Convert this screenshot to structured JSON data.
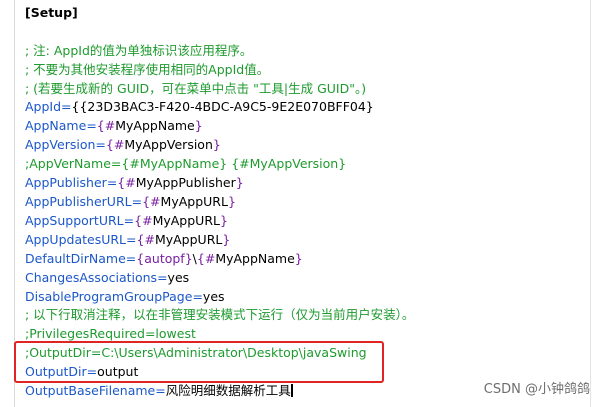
{
  "section": "[Setup]",
  "lines": {
    "c1": "; 注: AppId的值为单独标识该应用程序。",
    "c2": "; 不要为其他安装程序使用相同的AppId值。",
    "c3": "; (若要生成新的 GUID，可在菜单中点击 \"工具|生成 GUID\"。)",
    "appid_key": "AppId",
    "appid_val": "{{23D3BAC3-F420-4BDC-A9C5-9E2E070BFF04}",
    "appname_key": "AppName",
    "appname_const": "{#",
    "appname_val": "MyAppName",
    "appname_close": "}",
    "appversion_key": "AppVersion",
    "appversion_const": "{#",
    "appversion_val": "MyAppVersion",
    "appversion_close": "}",
    "appvername_comment": ";AppVerName={#MyAppName} {#MyAppVersion}",
    "publisher_key": "AppPublisher",
    "publisher_const": "{#",
    "publisher_val": "MyAppPublisher",
    "publisher_close": "}",
    "publisherurl_key": "AppPublisherURL",
    "publisherurl_const": "{#",
    "publisherurl_val": "MyAppURL",
    "publisherurl_close": "}",
    "supporturl_key": "AppSupportURL",
    "supporturl_const": "{#",
    "supporturl_val": "MyAppURL",
    "supporturl_close": "}",
    "updatesurl_key": "AppUpdatesURL",
    "updatesurl_const": "{#",
    "updatesurl_val": "MyAppURL",
    "updatesurl_close": "}",
    "defaultdir_key": "DefaultDirName",
    "defaultdir_const1": "{autopf}",
    "defaultdir_sep": "\\",
    "defaultdir_const2": "{#",
    "defaultdir_val": "MyAppName",
    "defaultdir_close": "}",
    "changes_key": "ChangesAssociations",
    "changes_val": "yes",
    "disable_key": "DisableProgramGroupPage",
    "disable_val": "yes",
    "c4": "; 以下行取消注释，以在非管理安装模式下运行（仅为当前用户安装）。",
    "privileges_comment": ";PrivilegesRequired=lowest",
    "outputdir_comment": ";OutputDir=C:\\Users\\Administrator\\Desktop\\javaSwing",
    "outputdir_key": "OutputDir",
    "outputdir_val": "output",
    "basefilename_key": "OutputBaseFilename",
    "basefilename_val": "风险明细数据解析工具"
  },
  "eq": "=",
  "watermark": "CSDN @小钟鸽鸽",
  "colors": {
    "comment": "#1e9a2e",
    "key": "#1b57c9",
    "constant": "#7a1fa2",
    "highlight_border": "#e02424"
  }
}
